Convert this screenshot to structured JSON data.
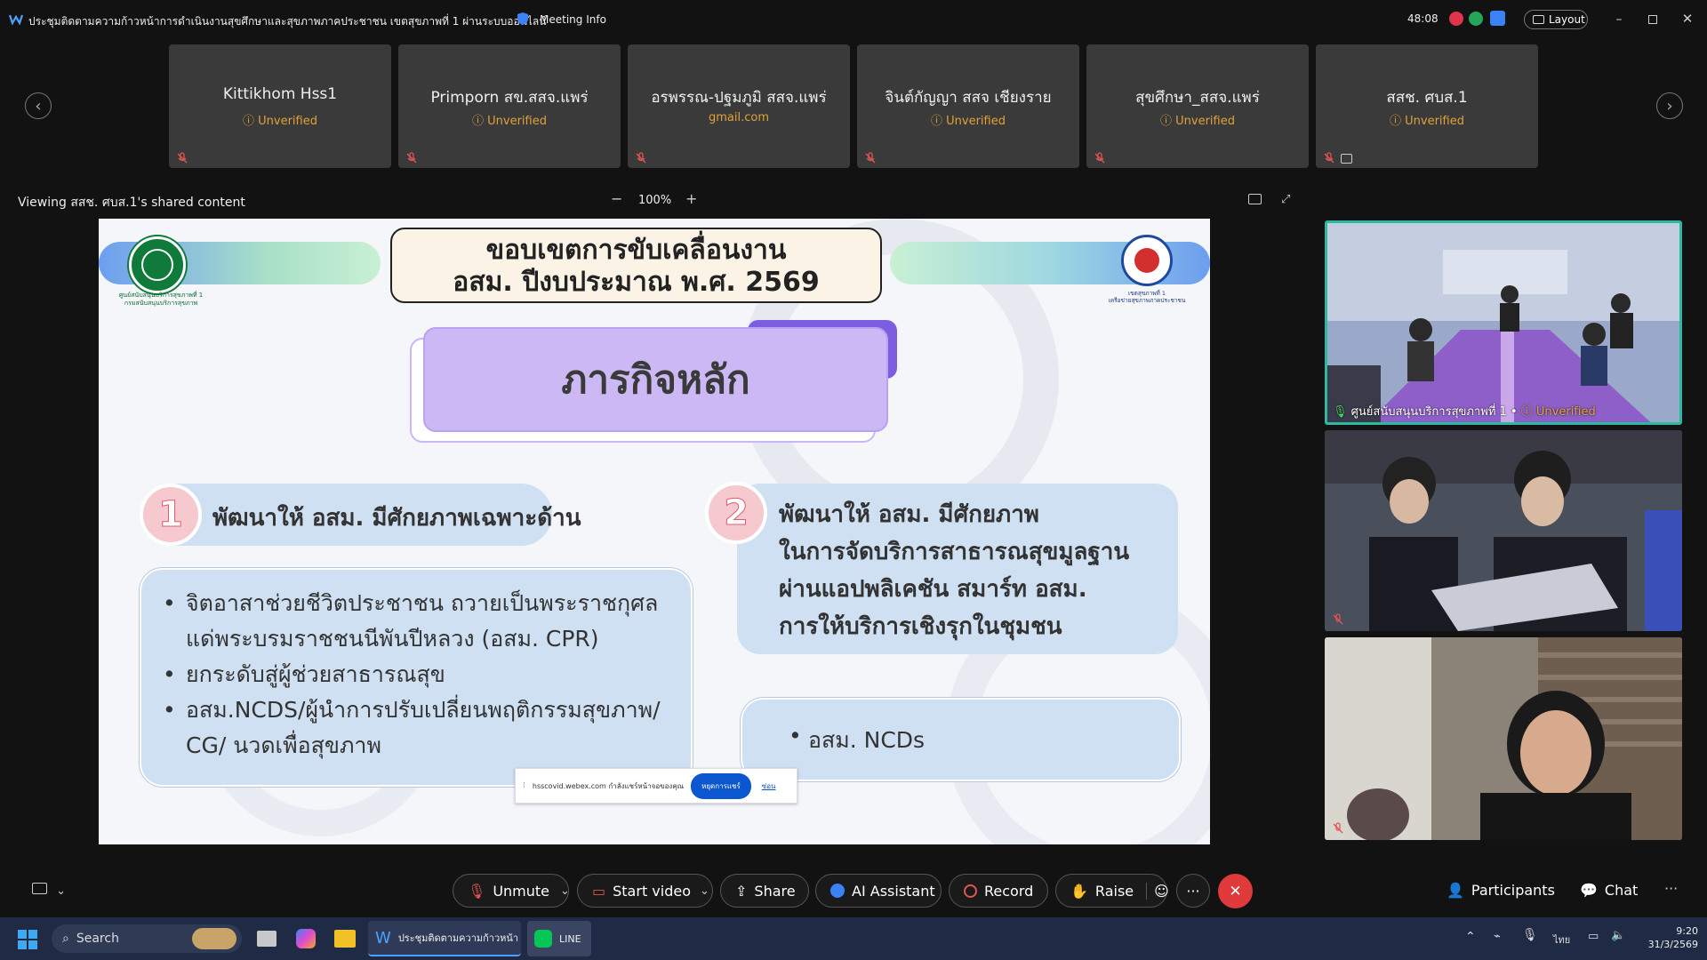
{
  "window": {
    "title": "ประชุมติดตามความก้าวหน้าการดำเนินงานสุขศึกษาและสุขภาพภาคประชาชน เขตสุขภาพที่ 1 ผ่านระบบออนไลน์",
    "meeting_info": "Meeting Info",
    "timer": "48:08",
    "layout_label": "Layout"
  },
  "participants_strip": [
    {
      "name": "Kittikhom Hss1",
      "status": "Unverified"
    },
    {
      "name": "Primporn สข.สสจ.แพร่",
      "status": "Unverified"
    },
    {
      "name": "อรพรรณ-ปฐมภูมิ สสจ.แพร่",
      "status": "gmail.com"
    },
    {
      "name": "จินต์กัญญา สสจ เชียงราย",
      "status": "Unverified"
    },
    {
      "name": "สุขศึกษา_สสจ.แพร่",
      "status": "Unverified"
    },
    {
      "name": "สสช. ศบส.1",
      "status": "Unverified"
    }
  ],
  "share_bar": {
    "viewing": "Viewing สสช. ศบส.1's shared content",
    "zoom": "100%",
    "minus": "−",
    "plus": "+"
  },
  "slide": {
    "title_line1": "ขอบเขตการขับเคลื่อนงาน",
    "title_line2": "อสม. ปีงบประมาณ พ.ศ. 2569",
    "logo_left_caption1": "ศูนย์สนับสนุนบริการสุขภาพที่ 1",
    "logo_left_caption2": "กรมสนับสนุนบริการสุขภาพ",
    "logo_right_caption1": "เขตสุขภาพที่ 1",
    "logo_right_caption2": "เครือข่ายสุขภาพภาคประชาชน",
    "mission": "ภารกิจหลัก",
    "num1": "1",
    "heading1": "พัฒนาให้ อสม. มีศักยภาพเฉพาะด้าน",
    "bullets1": [
      "จิตอาสาช่วยชีวิตประชาชน ถวายเป็นพระราชกุศล แด่พระบรมราชชนนีพันปีหลวง (อสม. CPR)",
      "ยกระดับสู่ผู้ช่วยสาธารณสุข",
      "อสม.NCDS/ผู้นำการปรับเปลี่ยนพฤติกรรมสุขภาพ/ CG/ นวดเพื่อสุขภาพ"
    ],
    "num2": "2",
    "heading2_lines": [
      "พัฒนาให้ อสม. มีศักยภาพ",
      "ในการจัดบริการสาธารณสุขมูลฐาน",
      "ผ่านแอปพลิเคชัน สมาร์ท อสม.",
      "การให้บริการเชิงรุกในชุมชน"
    ],
    "bullets2": [
      "อสม. NCDs"
    ]
  },
  "share_notice": {
    "text": "hsscovid.webex.com กำลังแชร์หน้าจอของคุณ",
    "stop_button": "หยุดการแชร์",
    "hide_link": "ซ่อน"
  },
  "video_tiles": [
    {
      "label": "ศูนย์สนับสนุนบริการสุขภาพที่ 1 •",
      "status": "Unverified"
    },
    {
      "label": ""
    },
    {
      "label": ""
    }
  ],
  "controls": {
    "unmute": "Unmute",
    "start_video": "Start video",
    "share": "Share",
    "ai_assistant": "AI Assistant",
    "record": "Record",
    "raise": "Raise",
    "more": "···",
    "participants": "Participants",
    "chat": "Chat",
    "overflow": "···"
  },
  "taskbar": {
    "search": "Search",
    "webex_app": "ประชุมติดตามความก้าวหน้า",
    "line_app": "LINE",
    "lang": "ไทย",
    "time": "9:20",
    "date": "31/3/2569"
  },
  "colors": {
    "bg": "#121212",
    "tile": "#3a3a3a",
    "unverified": "#e0a23a",
    "end_call": "#e03a3a",
    "active_border": "#2fb8a0",
    "lavender": "#cbb8f5",
    "slide_blue": "#cfe0f3"
  }
}
